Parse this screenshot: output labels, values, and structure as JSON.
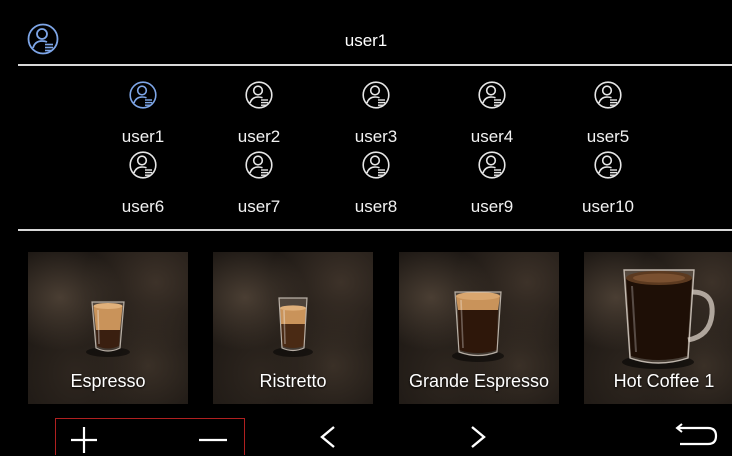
{
  "header": {
    "current_user": "user1",
    "icon": "user-profile-icon"
  },
  "colors": {
    "background": "#000000",
    "active_user_icon": "#7ea6e8",
    "user_icon": "#e6e6e6",
    "selection_border": "#b02020"
  },
  "users": [
    {
      "label": "user1",
      "icon": "user-profile-icon",
      "active": true
    },
    {
      "label": "user2",
      "icon": "user-profile-icon",
      "active": false
    },
    {
      "label": "user3",
      "icon": "user-profile-icon",
      "active": false
    },
    {
      "label": "user4",
      "icon": "user-profile-icon",
      "active": false
    },
    {
      "label": "user5",
      "icon": "user-profile-icon",
      "active": false
    },
    {
      "label": "user6",
      "icon": "user-profile-icon",
      "active": false
    },
    {
      "label": "user7",
      "icon": "user-profile-icon",
      "active": false
    },
    {
      "label": "user8",
      "icon": "user-profile-icon",
      "active": false
    },
    {
      "label": "user9",
      "icon": "user-profile-icon",
      "active": false
    },
    {
      "label": "user10",
      "icon": "user-profile-icon",
      "active": false
    }
  ],
  "drinks": [
    {
      "label": "Espresso",
      "icon": "espresso-cup-icon"
    },
    {
      "label": "Ristretto",
      "icon": "ristretto-cup-icon"
    },
    {
      "label": "Grande Espresso",
      "icon": "grande-espresso-cup-icon"
    },
    {
      "label": "Hot Coffee 1",
      "icon": "hot-coffee-mug-icon"
    }
  ],
  "controls": {
    "plus": "plus-icon",
    "minus": "minus-icon",
    "prev": "chevron-left-icon",
    "next": "chevron-right-icon",
    "back": "return-icon"
  }
}
